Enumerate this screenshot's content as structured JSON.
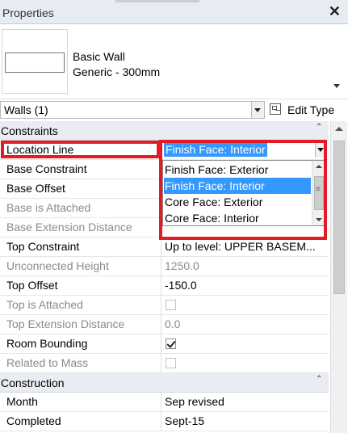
{
  "titlebar": {
    "title": "Properties",
    "close_label": "✕"
  },
  "type_selector": {
    "line1": "Basic Wall",
    "line2": "Generic - 300mm"
  },
  "selection": {
    "filter_label": "Walls (1)",
    "edit_type_label": "Edit Type"
  },
  "categories": [
    {
      "label": "Constraints",
      "collapse": "⌃"
    },
    {
      "label": "Construction",
      "collapse": "⌃"
    }
  ],
  "rows": {
    "location_line": {
      "name": "Location Line",
      "value": "Finish Face: Interior"
    },
    "base_constraint": {
      "name": "Base Constraint",
      "value": ""
    },
    "base_offset": {
      "name": "Base Offset",
      "value": ""
    },
    "base_attached": {
      "name": "Base is Attached",
      "value": ""
    },
    "base_ext": {
      "name": "Base Extension Distance",
      "value": ""
    },
    "top_constraint": {
      "name": "Top Constraint",
      "value": "Up to level: UPPER BASEM..."
    },
    "unconnected_height": {
      "name": "Unconnected Height",
      "value": "1250.0"
    },
    "top_offset": {
      "name": "Top Offset",
      "value": "-150.0"
    },
    "top_attached": {
      "name": "Top is Attached",
      "checked": false
    },
    "top_ext": {
      "name": "Top Extension Distance",
      "value": "0.0"
    },
    "room_bounding": {
      "name": "Room Bounding",
      "checked": true
    },
    "related_mass": {
      "name": "Related to Mass",
      "checked": false
    },
    "month": {
      "name": "Month",
      "value": "Sep revised"
    },
    "completed": {
      "name": "Completed",
      "value": "Sept-15"
    }
  },
  "dropdown": {
    "options": [
      "Finish Face: Exterior",
      "Finish Face: Interior",
      "Core Face: Exterior",
      "Core Face: Interior"
    ],
    "selected_index": 1
  },
  "colors": {
    "highlight": "#e11c24",
    "selection": "#3399ff",
    "category_bg": "#e9edf2"
  }
}
